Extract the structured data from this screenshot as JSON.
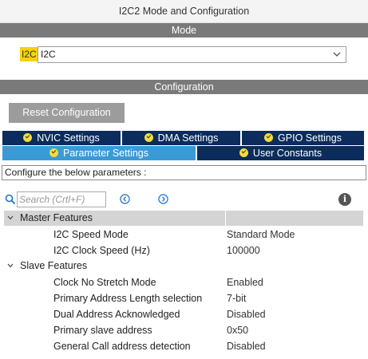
{
  "window": {
    "title": "I2C2 Mode and Configuration"
  },
  "mode_section": {
    "header": "Mode",
    "field_label": "I2C",
    "selected": "I2C"
  },
  "config_section": {
    "header": "Configuration",
    "reset_button": "Reset Configuration",
    "tabs_row1": [
      {
        "label": "NVIC Settings"
      },
      {
        "label": "DMA Settings"
      },
      {
        "label": "GPIO Settings"
      }
    ],
    "tabs_row2": [
      {
        "label": "Parameter Settings",
        "active": true
      },
      {
        "label": "User Constants",
        "active": false
      }
    ],
    "hint": "Configure the below parameters :",
    "search": {
      "placeholder": "Search (Crtl+F)"
    }
  },
  "groups": [
    {
      "name": "Master Features",
      "expanded": true,
      "params": [
        {
          "name": "I2C Speed Mode",
          "value": "Standard Mode"
        },
        {
          "name": "I2C Clock Speed (Hz)",
          "value": "100000"
        }
      ]
    },
    {
      "name": "Slave Features",
      "expanded": true,
      "params": [
        {
          "name": "Clock No Stretch Mode",
          "value": "Enabled"
        },
        {
          "name": "Primary Address Length selection",
          "value": "7-bit"
        },
        {
          "name": "Dual Address Acknowledged",
          "value": "Disabled"
        },
        {
          "name": "Primary slave address",
          "value": "0x50"
        },
        {
          "name": "General Call address detection",
          "value": "Disabled"
        }
      ]
    }
  ],
  "icons": {
    "search": "search-icon",
    "prev": "chevron-left-circle-icon",
    "next": "chevron-right-circle-icon",
    "info": "info-icon",
    "tab_status": "check-circle-icon",
    "dropdown": "chevron-down-icon",
    "group_toggle": "chevron-down-icon"
  },
  "colors": {
    "section_bar": "#7a7a7a",
    "tab_inactive": "#0b2c5c",
    "tab_active": "#3a9ad6",
    "check_badge": "#f2dc3c",
    "highlight": "#f6d200",
    "group_shade": "#d4d4d4"
  }
}
